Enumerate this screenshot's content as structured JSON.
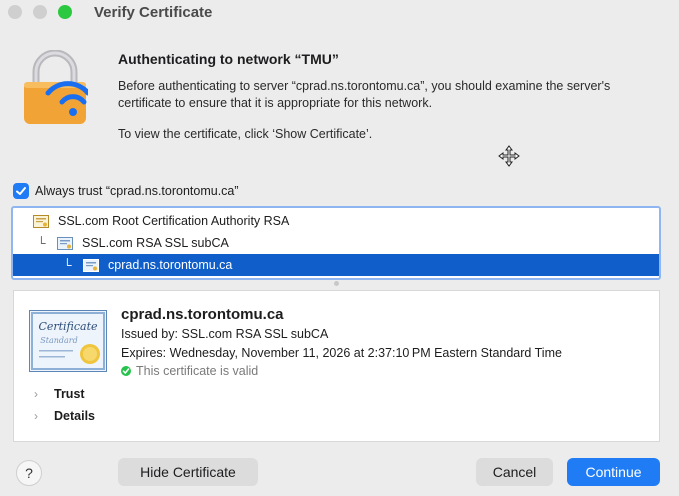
{
  "window": {
    "title": "Verify Certificate"
  },
  "auth": {
    "heading": "Authenticating to network “TMU”",
    "message": "Before authenticating to server “cprad.ns.torontomu.ca”, you should examine the server's certificate to ensure that it is appropriate for this network.",
    "view_hint": "To view the certificate, click ‘Show Certificate’."
  },
  "always_trust": {
    "label": "Always trust “cprad.ns.torontomu.ca”",
    "checked": true
  },
  "chain": [
    {
      "name": "SSL.com Root Certification Authority RSA",
      "selected": false
    },
    {
      "name": "SSL.com RSA SSL subCA",
      "selected": false
    },
    {
      "name": "cprad.ns.torontomu.ca",
      "selected": true
    }
  ],
  "detail": {
    "common_name": "cprad.ns.torontomu.ca",
    "issued_by": "Issued by: SSL.com RSA SSL subCA",
    "expires": "Expires: Wednesday, November 11, 2026 at 2:37:10 PM Eastern Standard Time",
    "status": "This certificate is valid",
    "badge_title": "Certificate",
    "badge_subtitle": "Standard",
    "sections": [
      "Trust",
      "Details"
    ]
  },
  "buttons": {
    "help": "?",
    "hide_certificate": "Hide Certificate",
    "cancel": "Cancel",
    "continue": "Continue"
  },
  "colors": {
    "accent": "#1f7cf4",
    "selection": "#0f5ec9",
    "valid_green": "#27c24c",
    "lock_orange": "#f2a336",
    "wifi_blue": "#1a6ff0"
  },
  "icons": [
    "lock-wifi-icon",
    "move-cursor-icon",
    "checkmark-icon",
    "certificate-icon",
    "certificate-badge-icon",
    "disclosure-chevron-icon"
  ]
}
